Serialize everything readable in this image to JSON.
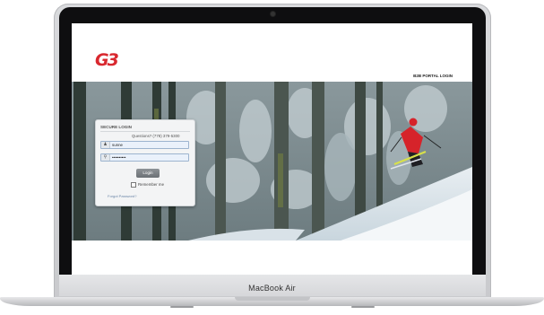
{
  "device": {
    "brand_label": "MacBook Air"
  },
  "site": {
    "logo_text": "G3",
    "portal_label": "B2B PORTAL LOGIN"
  },
  "login": {
    "title": "SECURE LOGIN",
    "questions": "Questions? (778) 379-5300",
    "username_value": "sunne",
    "password_value": "••••••••••",
    "login_button": "Login",
    "remember_label": "Remember me",
    "forgot_link": "Forgot Password?"
  },
  "colors": {
    "brand_red": "#d9282f",
    "field_highlight": "#eaf1fb",
    "button_gray": "#6b7075"
  },
  "icons": {
    "username_icon": "user-icon",
    "password_icon": "key-icon"
  }
}
